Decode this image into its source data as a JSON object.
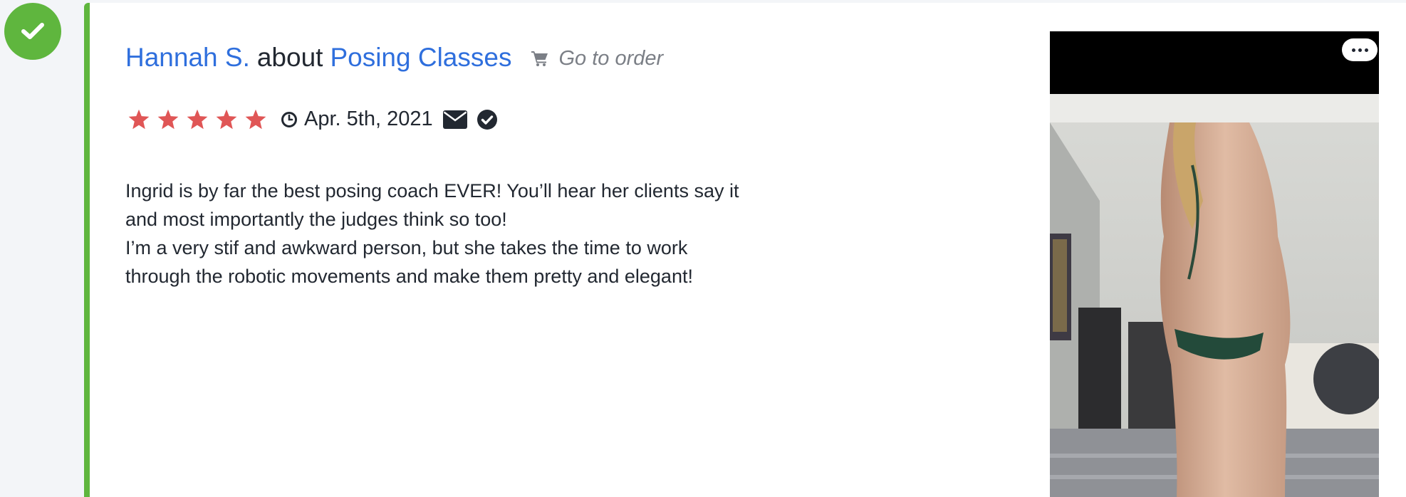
{
  "status": {
    "icon": "check-icon",
    "color": "#5fb63e"
  },
  "review": {
    "author": "Hannah S.",
    "about_word": "about",
    "product": "Posing Classes",
    "order_link": {
      "icon": "cart-icon",
      "label": "Go to order"
    },
    "rating": 5,
    "rating_max": 5,
    "star_color": "#e05656",
    "date": "Apr. 5th, 2021",
    "date_icon": "clock-icon",
    "contact_icon": "envelope-icon",
    "verified_icon": "check-circle-icon",
    "text_lines": [
      "Ingrid is by far the best posing coach EVER! You’ll hear her clients say it",
      "and most importantly the judges think so too!",
      "I’m a very stif and awkward person, but she takes the time to work",
      "through the robotic movements and make them pretty and elegant!"
    ]
  },
  "photo": {
    "more_icon": "more-dots-icon"
  },
  "colors": {
    "link": "#2f6fdd",
    "accent_green": "#5fb63e",
    "text": "#222831",
    "muted": "#7b7f86"
  }
}
